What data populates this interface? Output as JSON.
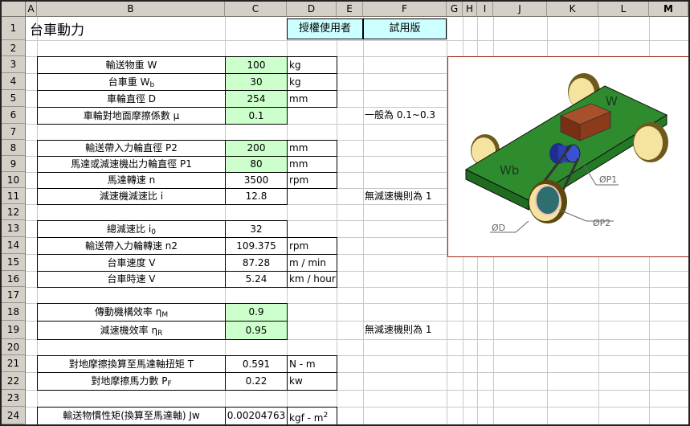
{
  "columns": [
    "A",
    "B",
    "C",
    "D",
    "E",
    "F",
    "G",
    "H",
    "I",
    "J",
    "K",
    "L",
    "M"
  ],
  "rows": [
    "1",
    "2",
    "3",
    "4",
    "5",
    "6",
    "7",
    "8",
    "9",
    "10",
    "11",
    "12",
    "13",
    "14",
    "15",
    "16",
    "17",
    "18",
    "19",
    "20",
    "21",
    "22",
    "23",
    "24"
  ],
  "title": "台車動力",
  "license_button": "授權使用者",
  "trial_label": "試用版",
  "params": {
    "r3": {
      "label": "輸送物重  W",
      "value": "100",
      "unit": "kg"
    },
    "r4": {
      "label_main": "台車重  W",
      "label_sub": "b",
      "value": "30",
      "unit": "kg"
    },
    "r5": {
      "label": "車輪直徑  D",
      "value": "254",
      "unit": "mm"
    },
    "r6": {
      "label": "車輪對地面摩擦係數  μ",
      "value": "0.1",
      "note": "一般為 0.1~0.3"
    },
    "r8": {
      "label": "輸送帶入力輪直徑  P2",
      "value": "200",
      "unit": "mm"
    },
    "r9": {
      "label": "馬達或減速機出力輪直徑  P1",
      "value": "80",
      "unit": "mm"
    },
    "r10": {
      "label": "馬達轉速  n",
      "value": "3500",
      "unit": "rpm"
    },
    "r11": {
      "label": "減速機減速比  i",
      "value": "12.8",
      "note": "無減速機則為 1"
    },
    "r13": {
      "label_main": "總減速比  i",
      "label_sub": "0",
      "value": "32"
    },
    "r14": {
      "label": "輸送帶入力輪轉速  n2",
      "value": "109.375",
      "unit": "rpm"
    },
    "r15": {
      "label": "台車速度  V",
      "value": "87.28",
      "unit": "m / min"
    },
    "r16": {
      "label": "台車時速  V",
      "value": "5.24",
      "unit": "km / hour"
    },
    "r18": {
      "label_main": "傳動機構效率  η",
      "label_sub": "M",
      "value": "0.9"
    },
    "r19": {
      "label_main": "減速機效率  η",
      "label_sub": "R",
      "value": "0.95",
      "note": "無減速機則為 1"
    },
    "r21": {
      "label": "對地摩擦換算至馬達軸扭矩  T",
      "value": "0.591",
      "unit": "N - m"
    },
    "r22": {
      "label_main": "對地摩擦馬力數  P",
      "label_sub": "F",
      "value": "0.22",
      "unit": "kw"
    },
    "r24": {
      "label": "輸送物慣性矩(換算至馬達軸)  Jw",
      "value": "0.00204763",
      "unit_main": "kgf - m",
      "unit_sup": "2"
    }
  },
  "diagram": {
    "label_w": "W",
    "label_wb": "Wb",
    "label_p1": "ØP1",
    "label_p2": "ØP2",
    "label_d": "ØD",
    "colors": {
      "deck": "#2e8b2e",
      "wheel": "#f5e4a0",
      "box": "#8b3a1a",
      "motor": "#2a3eb0"
    }
  }
}
